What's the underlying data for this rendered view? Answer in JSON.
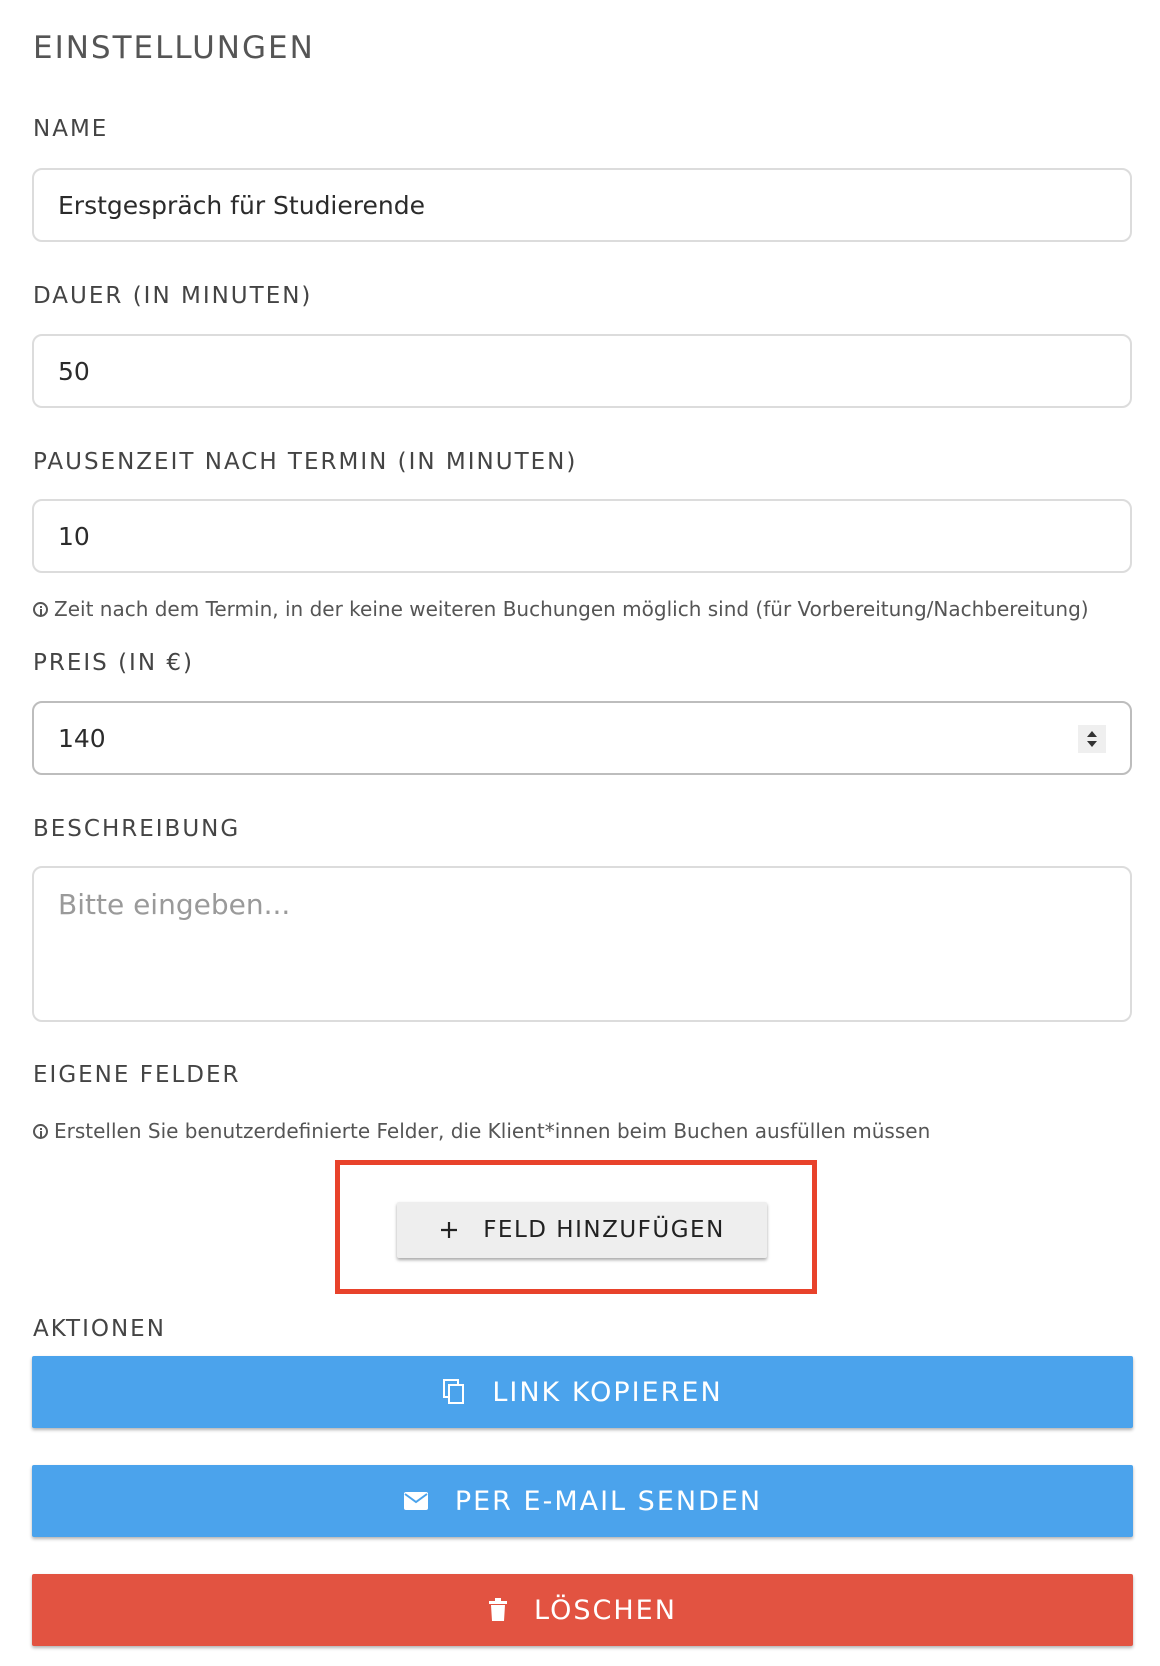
{
  "settings": {
    "title": "EINSTELLUNGEN"
  },
  "name_field": {
    "label": "NAME",
    "value": "Erstgespräch für Studierende"
  },
  "duration_field": {
    "label": "DAUER (IN MINUTEN)",
    "value": "50"
  },
  "break_field": {
    "label": "PAUSENZEIT NACH TERMIN (IN MINUTEN)",
    "value": "10",
    "hint": "Zeit nach dem Termin, in der keine weiteren Buchungen möglich sind (für Vorbereitung/Nachbereitung)"
  },
  "price_field": {
    "label": "PREIS (IN €)",
    "value": "140"
  },
  "description_field": {
    "label": "BESCHREIBUNG",
    "placeholder": "Bitte eingeben..."
  },
  "custom_fields": {
    "label": "EIGENE FELDER",
    "hint": "Erstellen Sie benutzerdefinierte Felder, die Klient*innen beim Buchen ausfüllen müssen",
    "add_button_label": "FELD HINZUFÜGEN",
    "highlight_color": "#e8422b"
  },
  "actions": {
    "label": "AKTIONEN",
    "copy_link_label": "LINK KOPIEREN",
    "email_label": "PER E-MAIL SENDEN",
    "delete_label": "LÖSCHEN",
    "primary_color": "#4ba3ec",
    "danger_color": "#e25341"
  },
  "icons": {
    "info": "info-circle-icon",
    "add": "plus-icon",
    "copy": "copy-icon",
    "email": "envelope-icon",
    "delete": "trash-icon"
  }
}
